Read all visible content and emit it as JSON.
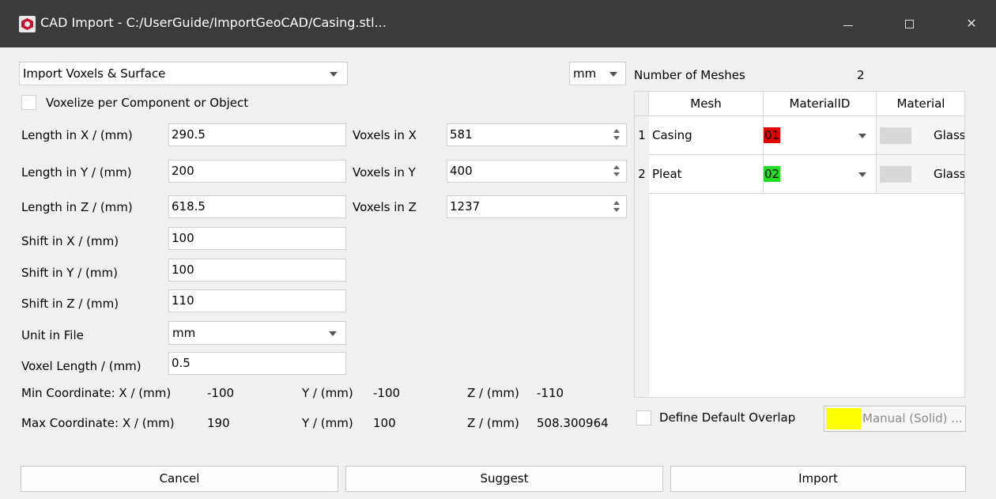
{
  "window": {
    "title": "CAD Import - C:/UserGuide/ImportGeoCAD/Casing.stl...",
    "minimize_glyph": "—",
    "maximize_glyph": "☐",
    "close_glyph": "✕"
  },
  "import_mode": {
    "selected": "Import Voxels & Surface"
  },
  "unit_combo": {
    "selected": "mm"
  },
  "voxelize_per_component": {
    "label": "Voxelize per Component or Object",
    "checked": false
  },
  "lengths": [
    {
      "label": "Length in X / (mm)",
      "value": "290.5",
      "voxels_label": "Voxels in X",
      "voxels": "581"
    },
    {
      "label": "Length in Y / (mm)",
      "value": "200",
      "voxels_label": "Voxels in Y",
      "voxels": "400"
    },
    {
      "label": "Length in Z / (mm)",
      "value": "618.5",
      "voxels_label": "Voxels in Z",
      "voxels": "1237"
    }
  ],
  "shifts": [
    {
      "label": "Shift  in X / (mm)",
      "value": "100"
    },
    {
      "label": "Shift  in Y / (mm)",
      "value": "100"
    },
    {
      "label": "Shift  in Z / (mm)",
      "value": "110"
    }
  ],
  "unit_in_file": {
    "label": "Unit in File",
    "selected": "mm"
  },
  "voxel_length": {
    "label": "Voxel Length / (mm)",
    "value": "0.5"
  },
  "min_coordinate": {
    "label": "Min Coordinate: X / (mm)",
    "x": "-100",
    "y_label": "Y / (mm)",
    "y": "-100",
    "z_label": "Z / (mm)",
    "z": "-110"
  },
  "max_coordinate": {
    "label": "Max Coordinate: X / (mm)",
    "x": "190",
    "y_label": "Y / (mm)",
    "y": "100",
    "z_label": "Z / (mm)",
    "z": "508.300964"
  },
  "meshes": {
    "count_label": "Number of Meshes",
    "count": "2",
    "columns": [
      "Mesh",
      "MaterialID",
      "Material"
    ],
    "rows": [
      {
        "index": "1",
        "mesh": "Casing",
        "material_id": "01",
        "id_color": "#e60000",
        "material": "Glass (Solid)"
      },
      {
        "index": "2",
        "mesh": "Pleat",
        "material_id": "02",
        "id_color": "#22dd22",
        "material": "Glass (Solid)"
      }
    ]
  },
  "default_overlap": {
    "label": "Define Default Overlap",
    "checked": false,
    "button_label": "Manual (Solid) ...",
    "color": "#ffff00"
  },
  "buttons": {
    "cancel": "Cancel",
    "suggest": "Suggest",
    "import": "Import"
  }
}
